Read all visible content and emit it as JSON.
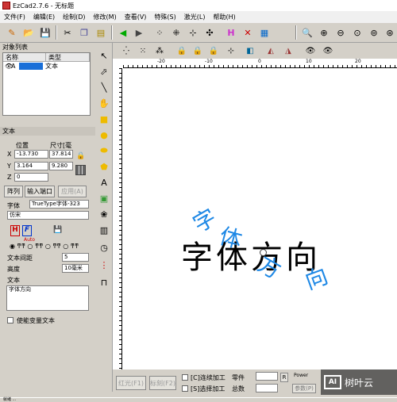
{
  "window": {
    "title": "EzCad2.7.6 - 无标题"
  },
  "menu": [
    "文件(F)",
    "编辑(E)",
    "绘制(D)",
    "修改(M)",
    "查看(V)",
    "特殊(S)",
    "激光(L)",
    "帮助(H)"
  ],
  "objects": {
    "title": "对象列表",
    "col_name": "名称",
    "col_type": "类型",
    "row_name": "A",
    "row_type": "文本"
  },
  "props": {
    "title": "文本",
    "pos_label": "位置",
    "size_label": "尺寸[毫",
    "x_label": "X",
    "y_label": "Y",
    "z_label": "Z",
    "x_pos": "-13.730",
    "x_size": "37.814",
    "y_pos": "3.164",
    "y_size": "9.280",
    "z_pos": "0",
    "tab_array": "阵列",
    "tab_input": "输入端口",
    "apply": "应用(A)",
    "font_label": "字体",
    "font_type": "TrueType字体-323",
    "font_name": "仿宋",
    "auto_label": "Auto",
    "spacing_label": "文本间距",
    "spacing_value": "5",
    "height_label": "高度",
    "height_value": "10毫米",
    "text_label": "文本",
    "text_value": "字体方向",
    "variable_label": "使能变量文本"
  },
  "ruler": {
    "h_ticks": [
      "-20",
      "-10",
      "0",
      "10",
      "20"
    ]
  },
  "canvas": {
    "main_text": "字体方向",
    "arc_chars": [
      "字",
      "体",
      "方",
      "向"
    ],
    "diag_chars": [
      "体",
      "方",
      "向"
    ]
  },
  "bottom": {
    "red_button": "红光(F1)",
    "mark_button": "标刻(F2)",
    "continuous": "[C]连续加工",
    "select": "[S]选择加工",
    "parts_label": "零件",
    "total_label": "总数",
    "power_label": "Power",
    "param_button": "参数(P)",
    "r_button": "R",
    "watermark": "树叶云"
  },
  "status": {
    "text": "就绪 ..."
  }
}
